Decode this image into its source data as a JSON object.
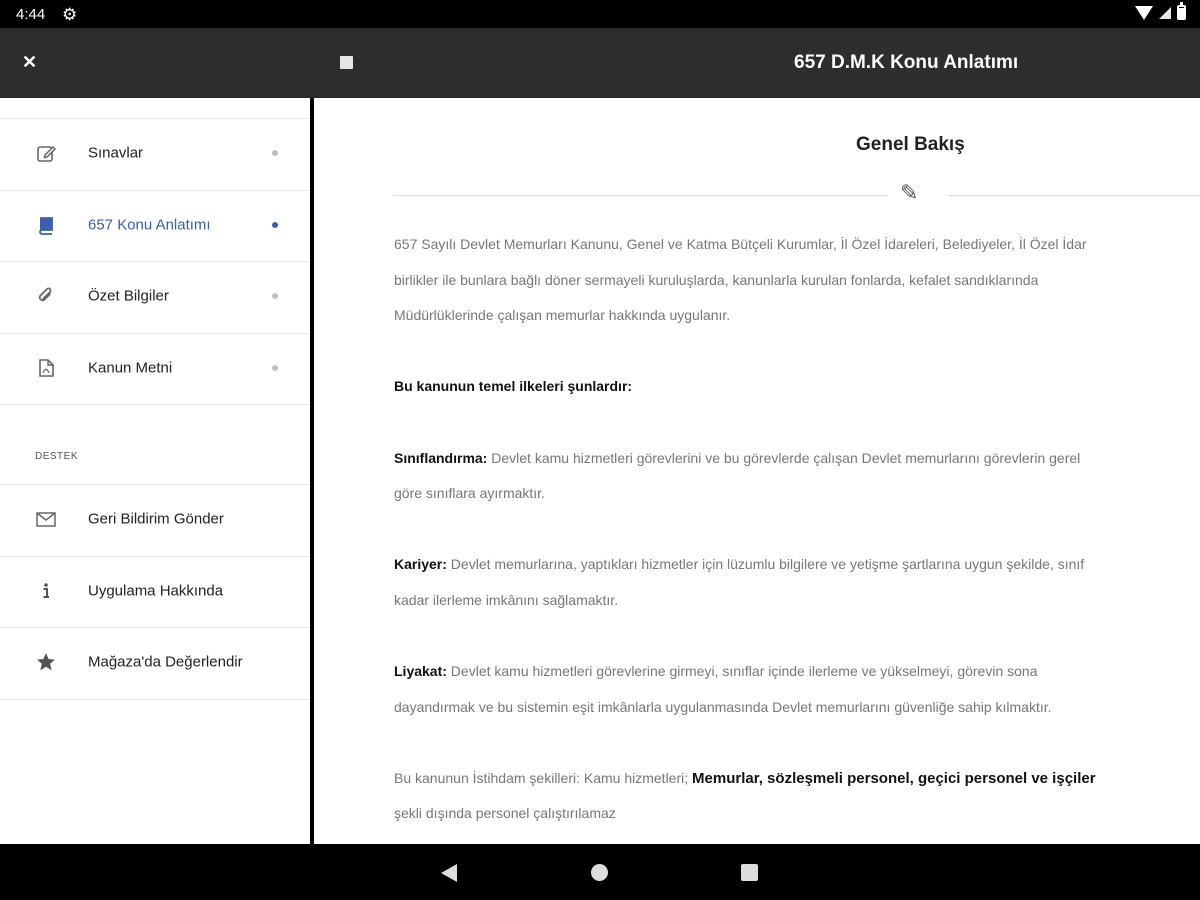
{
  "status_bar": {
    "time": "4:44"
  },
  "app_bar": {
    "title": "657 D.M.K Konu Anlatımı"
  },
  "drawer": {
    "items": [
      {
        "label": "Sınavlar",
        "icon": "edit-icon"
      },
      {
        "label": "657 Konu Anlatımı",
        "icon": "book-icon",
        "active": true
      },
      {
        "label": "Özet Bilgiler",
        "icon": "paperclip-icon"
      },
      {
        "label": "Kanun Metni",
        "icon": "pdf-icon"
      }
    ],
    "section_label": "DESTEK",
    "support_items": [
      {
        "label": "Geri Bildirim Gönder",
        "icon": "mail-icon"
      },
      {
        "label": "Uygulama Hakkında",
        "icon": "info-icon"
      },
      {
        "label": "Mağaza'da Değerlendir",
        "icon": "star-icon"
      }
    ]
  },
  "content": {
    "title": "Genel Bakış",
    "p1_l1": "657 Sayılı Devlet Memurları Kanunu, Genel ve Katma Bütçeli Kurumlar, İl Özel İdareleri, Belediyeler, İl Özel İdar",
    "p1_l2": "birlikler  ile  bunlara  bağlı  döner  sermayeli  kuruluşlarda,  kanunlarla  kurulan  fonlarda,  kefalet  sandıklarında",
    "p1_l3": "Müdürlüklerinde çalışan memurlar hakkında uygulanır.",
    "principles_heading": "Bu kanunun temel ilkeleri şunlardır:",
    "p2_term": "Sınıflandırma:",
    "p2_l1": " Devlet kamu hizmetleri görevlerini ve bu görevlerde çalışan Devlet memurlarını görevlerin gerel",
    "p2_l2": "göre sınıflara ayırmaktır.",
    "p3_term": "Kariyer:",
    "p3_l1": " Devlet memurlarına, yaptıkları hizmetler için lüzumlu bilgilere ve yetişme şartlarına uygun şekilde, sınıf",
    "p3_l2": "kadar ilerleme imkânını sağlamaktır.",
    "p4_term": "Liyakat:",
    "p4_l1": "  Devlet  kamu  hizmetleri  görevlerine  girmeyi,  sınıflar  içinde  ilerleme  ve  yükselmeyi,  görevin  sona",
    "p4_l2": "dayandırmak ve bu sistemin eşit imkânlarla uygulanmasında Devlet memurlarını güvenliğe sahip kılmaktır.",
    "p5_prefix": "Bu kanunun İstihdam şekilleri: Kamu hizmetleri; ",
    "p5_bold": "Memurlar, sözleşmeli personel, geçici personel ve işçiler",
    "p5_l2": "şekli dışında personel çalıştırılamaz"
  }
}
